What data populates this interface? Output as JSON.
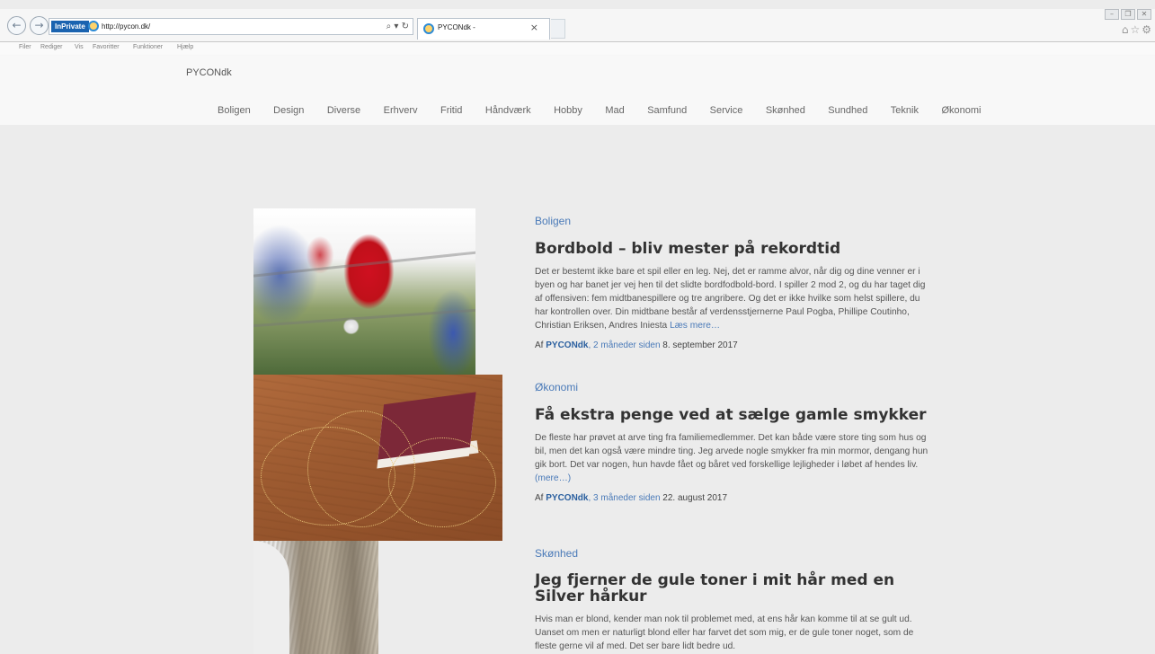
{
  "browser": {
    "inprivate_label": "InPrivate",
    "url": "http://pycon.dk/",
    "address_tools": "⌕ ▾ ↻",
    "tab_title": "PYCONdk -",
    "tab_close": "×",
    "menu": [
      "Filer",
      "Rediger",
      "Vis",
      "Favoritter",
      "Funktioner",
      "Hjælp"
    ],
    "back_glyph": "←",
    "forward_glyph": "→",
    "window_glyphs": [
      "–",
      "❐",
      "✕"
    ],
    "right_icons": "⌂☆⚙"
  },
  "site": {
    "logo": "PYCONdk",
    "nav": [
      "Boligen",
      "Design",
      "Diverse",
      "Erhverv",
      "Fritid",
      "Håndværk",
      "Hobby",
      "Mad",
      "Samfund",
      "Service",
      "Skønhed",
      "Sundhed",
      "Teknik",
      "Økonomi"
    ]
  },
  "articles": [
    {
      "category": "Boligen",
      "title": "Bordbold – bliv mester på rekordtid",
      "excerpt": "Det er bestemt ikke bare et spil eller en leg. Nej, det er ramme alvor, når dig og dine venner er i byen og har banet jer vej hen til det slidte bordfodbold-bord. I spiller 2 mod 2, og du har taget dig af offensiven: fem midtbanespillere og tre angribere. Og det er ikke hvilke som helst spillere, du har kontrollen over. Din midtbane består af verdensstjernerne Paul Pogba, Phillipe Coutinho, Christian Eriksen, Andres Iniesta ",
      "readmore": "Læs mere…",
      "meta_prefix": "Af ",
      "author": "PYCONdk",
      "ago": ", 2 måneder siden",
      "date": " 8. september 2017"
    },
    {
      "category": "Økonomi",
      "title": "Få ekstra penge ved at sælge gamle smykker",
      "excerpt": "De fleste har prøvet at arve ting fra familiemedlemmer. Det kan både være store ting som hus og bil, men det kan også være mindre ting. Jeg arvede nogle smykker fra min mormor, dengang hun gik bort. Det var nogen, hun havde fået og båret ved forskellige lejligheder i løbet af hendes liv. ",
      "readmore": "(mere…)",
      "meta_prefix": "Af ",
      "author": "PYCONdk",
      "ago": ", 3 måneder siden",
      "date": " 22. august 2017"
    },
    {
      "category": "Skønhed",
      "title": "Jeg fjerner de gule toner i mit hår med en Silver hårkur",
      "excerpt": "Hvis man er blond, kender man nok til problemet med, at ens hår kan komme til at se gult ud. Uanset om men er naturligt blond eller har farvet det som mig, er de gule toner noget, som de fleste gerne vil af med. Det ser bare lidt bedre ud."
    }
  ]
}
